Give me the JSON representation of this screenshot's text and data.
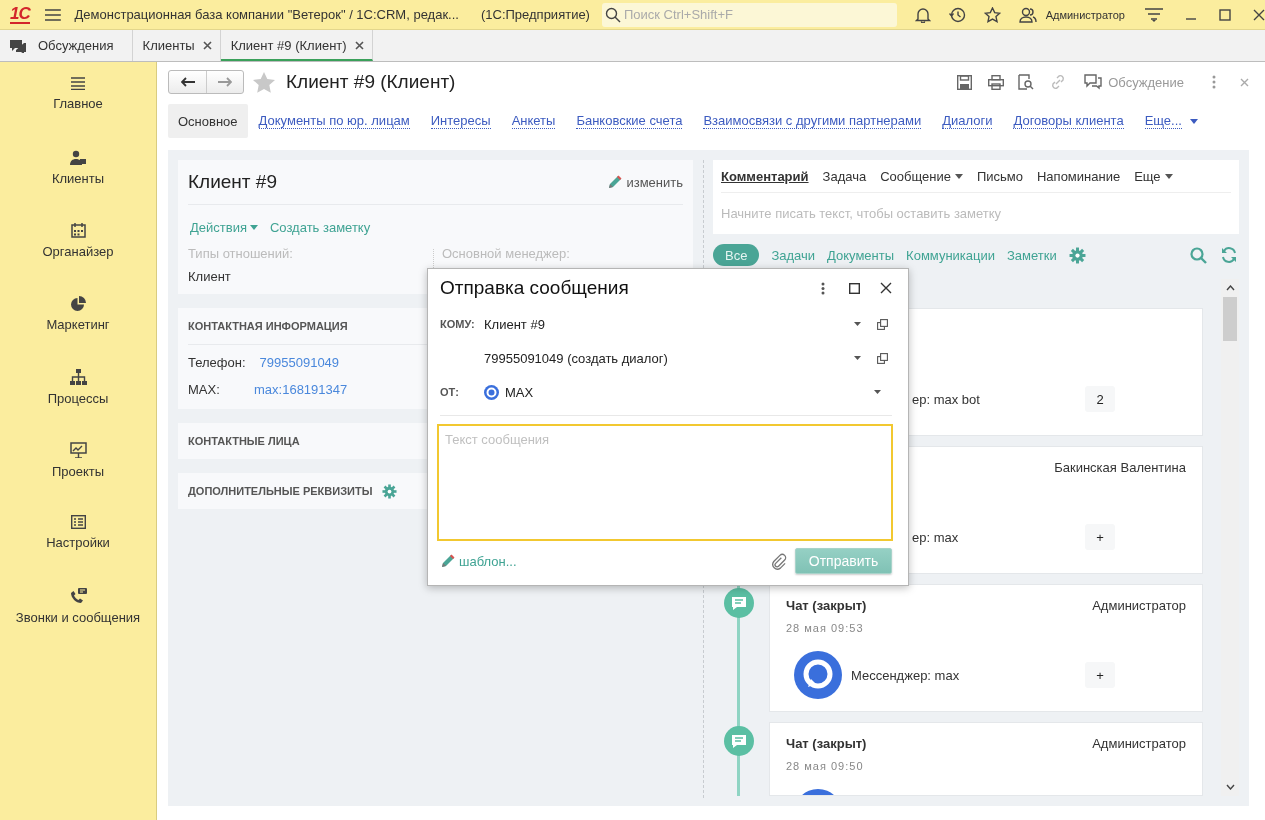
{
  "window": {
    "logo": "1С",
    "title": "Демонстрационная база компании \"Ветерок\" / 1С:CRM, редак...",
    "app": "(1С:Предприятие)",
    "search_placeholder": "Поиск Ctrl+Shift+F",
    "user": "Администратор"
  },
  "open_tabs": [
    {
      "label": "Обсуждения",
      "kind": "pinned",
      "selected": false
    },
    {
      "label": "Клиенты",
      "kind": "document",
      "selected": false
    },
    {
      "label": "Клиент #9 (Клиент)",
      "kind": "document",
      "selected": true
    }
  ],
  "sidebar": {
    "items": [
      {
        "label": "Главное"
      },
      {
        "label": "Клиенты"
      },
      {
        "label": "Органайзер"
      },
      {
        "label": "Маркетинг"
      },
      {
        "label": "Процессы"
      },
      {
        "label": "Проекты"
      },
      {
        "label": "Настройки"
      },
      {
        "label": "Звонки и сообщения"
      }
    ]
  },
  "form": {
    "title": "Клиент #9 (Клиент)",
    "discussion": "Обсуждение",
    "tabs": [
      {
        "label": "Основное",
        "kind": "tab",
        "selected": true
      },
      {
        "label": "Документы по юр. лицам",
        "kind": "tab",
        "selected": false
      },
      {
        "label": "Интересы",
        "kind": "tab",
        "selected": false
      },
      {
        "label": "Анкеты",
        "kind": "tab",
        "selected": false
      },
      {
        "label": "Банковские счета",
        "kind": "tab",
        "selected": false
      },
      {
        "label": "Взаимосвязи с другими партнерами",
        "kind": "tab",
        "selected": false
      },
      {
        "label": "Диалоги",
        "kind": "tab",
        "selected": false
      },
      {
        "label": "Договоры клиента",
        "kind": "tab",
        "selected": false
      },
      {
        "label": "Еще...",
        "kind": "more",
        "selected": false
      }
    ]
  },
  "client_card": {
    "name": "Клиент #9",
    "edit": "изменить",
    "actions": "Действия",
    "create_note": "Создать заметку",
    "relation_label": "Типы отношений:",
    "relation_value": "Клиент",
    "manager_label": "Основной менеджер:"
  },
  "sections": [
    {
      "title": "КОНТАКТНАЯ ИНФОРМАЦИЯ",
      "settings": false,
      "fields": [
        {
          "label": "Телефон:",
          "value": "79955091049"
        },
        {
          "label": "MAX:",
          "value": "max:168191347"
        }
      ]
    },
    {
      "title": "КОНТАКТНЫЕ ЛИЦА",
      "settings": false
    },
    {
      "title": "ДОПОЛНИТЕЛЬНЫЕ РЕКВИЗИТЫ",
      "settings": true
    }
  ],
  "composer": {
    "tabs": [
      {
        "label": "Комментарий",
        "selected": true,
        "dropdown": false
      },
      {
        "label": "Задача",
        "selected": false,
        "dropdown": false
      },
      {
        "label": "Сообщение",
        "selected": false,
        "dropdown": true
      },
      {
        "label": "Письмо",
        "selected": false,
        "dropdown": false
      },
      {
        "label": "Напоминание",
        "selected": false,
        "dropdown": false
      },
      {
        "label": "Еще",
        "selected": false,
        "dropdown": true
      }
    ],
    "placeholder": "Начните писать текст, чтобы оставить заметку"
  },
  "filters": [
    {
      "label": "Все",
      "selected": true
    },
    {
      "label": "Задачи",
      "selected": false
    },
    {
      "label": "Документы",
      "selected": false
    },
    {
      "label": "Коммуникации",
      "selected": false
    },
    {
      "label": "Заметки",
      "selected": false
    }
  ],
  "feed": [
    {
      "kind": "partial",
      "text": "ер: max bot",
      "badge": "2"
    },
    {
      "kind": "partial",
      "author": "Бакинская Валентина",
      "text": "ер: max",
      "badge": "+"
    },
    {
      "kind": "full",
      "title": "Чат (закрыт)",
      "author": "Администратор",
      "date": "28 мая 09:53",
      "text": "Мессенджер: max",
      "badge": "+"
    },
    {
      "kind": "full",
      "title": "Чат (закрыт)",
      "author": "Администратор",
      "date": "28 мая 09:50"
    }
  ],
  "dialog": {
    "title": "Отправка сообщения",
    "to_label": "КОМУ:",
    "to": "Клиент #9",
    "address": "79955091049 (создать диалог)",
    "from_label": "ОТ:",
    "from": "MAX",
    "placeholder": "Текст сообщения",
    "template": "шаблон...",
    "send": "Отправить"
  }
}
